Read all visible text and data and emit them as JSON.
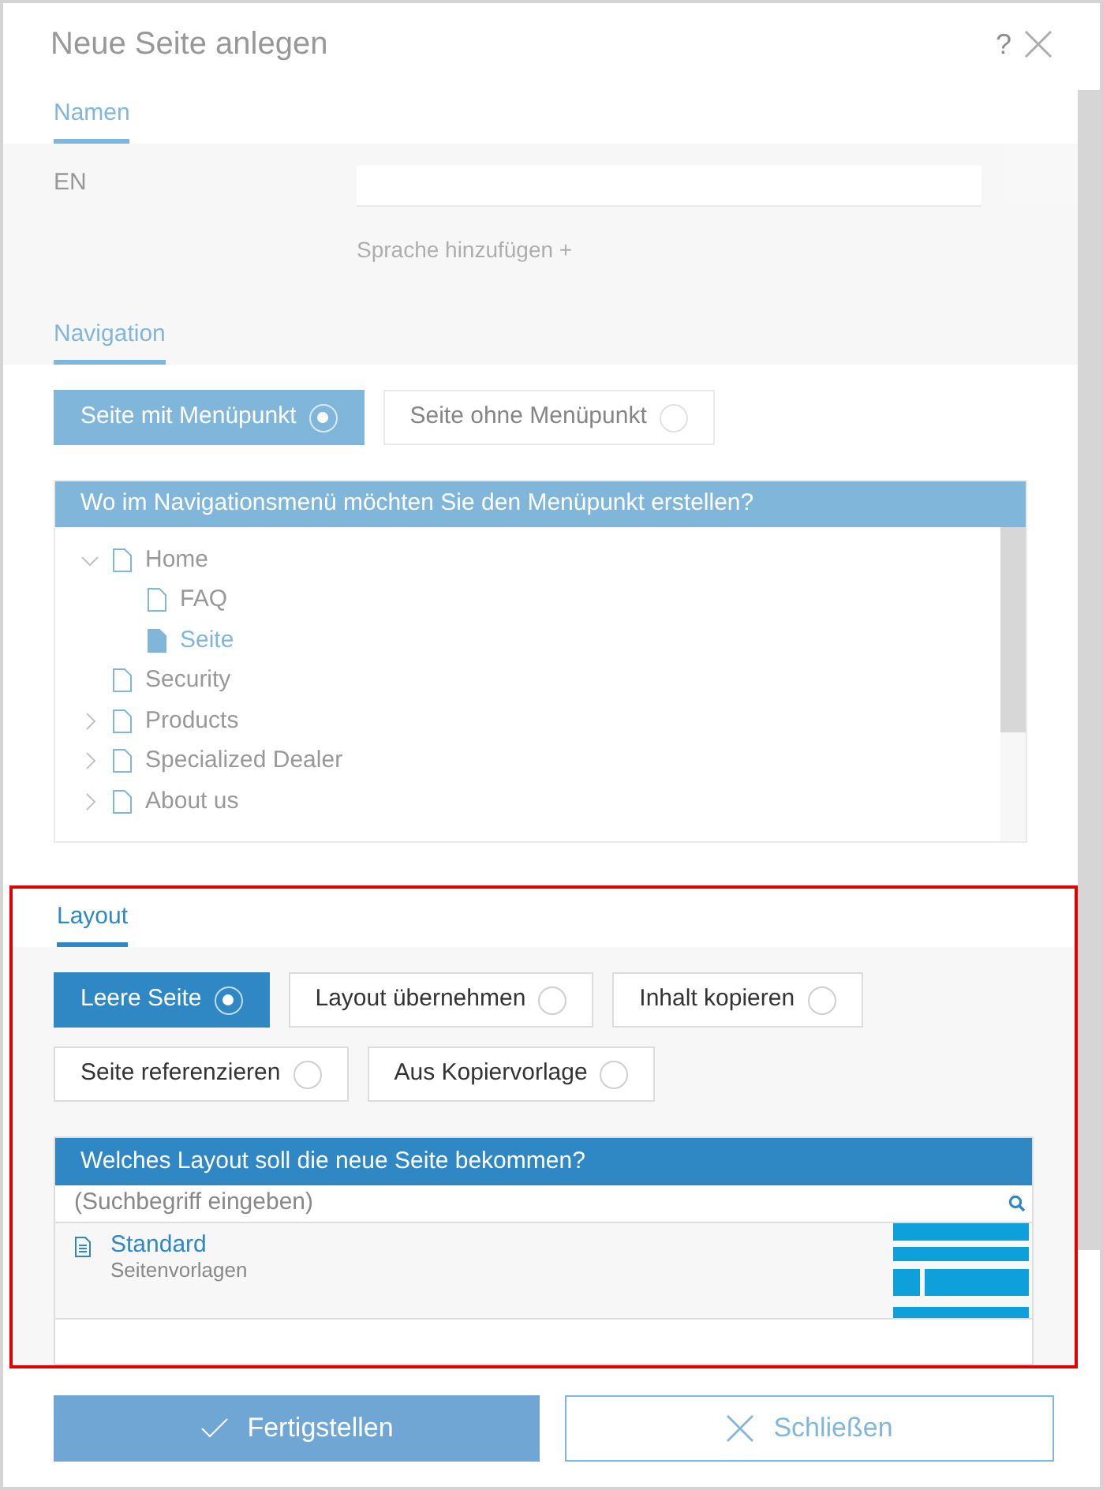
{
  "dialog": {
    "title": "Neue Seite anlegen",
    "help": "?",
    "dimmed": true
  },
  "names_section": {
    "tab": "Namen",
    "dimmed": true,
    "fields": [
      {
        "label": "EN"
      }
    ],
    "add_language": "Sprache hinzufügen +"
  },
  "navigation_section": {
    "tab": "Navigation",
    "dimmed": true,
    "options": [
      {
        "label": "Seite mit Menüpunkt",
        "selected": true
      },
      {
        "label": "Seite ohne Menüpunkt",
        "selected": false
      }
    ],
    "tree": {
      "header": "Wo im Navigationsmenü möchten Sie den Menüpunkt erstellen?",
      "items": [
        {
          "label": "Home",
          "expanded": true,
          "selected": false,
          "children": [
            {
              "label": "FAQ",
              "selected": false
            },
            {
              "label": "Seite",
              "selected": true
            }
          ]
        },
        {
          "label": "Security",
          "selected": false
        },
        {
          "label": "Products",
          "expanded": false,
          "selected": false
        },
        {
          "label": "Specialized Dealer",
          "expanded": false,
          "selected": false
        },
        {
          "label": "About us",
          "expanded": false,
          "selected": false
        }
      ]
    }
  },
  "layout_section": {
    "tab": "Layout",
    "dimmed": false,
    "highlighted": true,
    "options": [
      {
        "label": "Leere Seite",
        "selected": true
      },
      {
        "label": "Layout übernehmen",
        "selected": false
      },
      {
        "label": "Inhalt kopieren",
        "selected": false
      },
      {
        "label": "Seite referenzieren",
        "selected": false
      },
      {
        "label": "Aus Kopiervorlage",
        "selected": false
      }
    ],
    "list": {
      "header": "Welches Layout soll die neue Seite bekommen?",
      "search": {
        "placeholder": "(Suchbegriff eingeben)"
      },
      "items": [
        {
          "title": "Standard",
          "subtitle": "Seitenvorlagen"
        }
      ]
    }
  },
  "footer": {
    "dimmed": true,
    "buttons": [
      {
        "label": "Fertigstellen",
        "kind": "confirm",
        "disabled": true
      },
      {
        "label": "Schließen",
        "kind": "close",
        "disabled": false
      }
    ]
  }
}
